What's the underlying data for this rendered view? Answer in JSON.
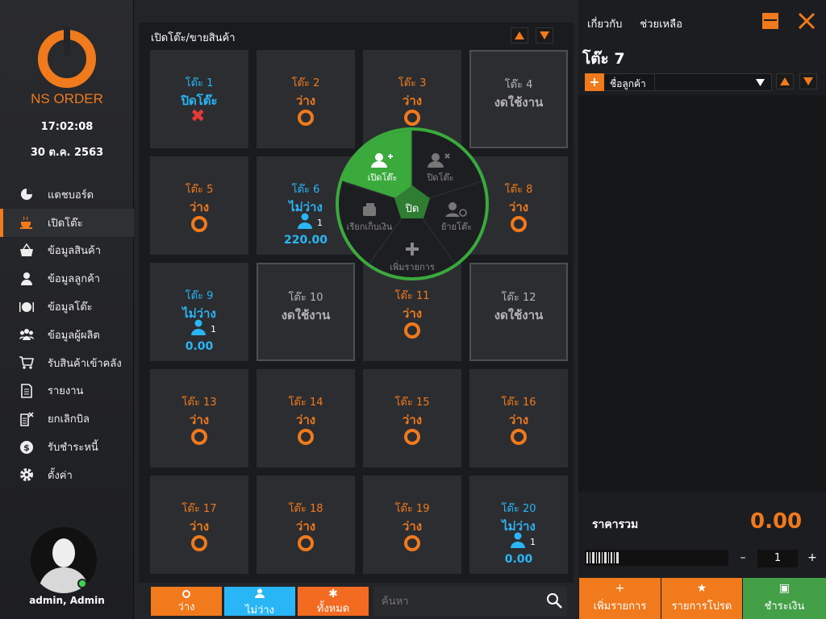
{
  "app": {
    "logo_text": "NS ORDER",
    "time": "17:02:08",
    "date": "30 ต.ค. 2563",
    "user": "admin, Admin"
  },
  "nav": [
    {
      "label": "แดชบอร์ด",
      "icon": "pie-chart-icon"
    },
    {
      "label": "เปิดโต๊ะ",
      "icon": "coffee-icon"
    },
    {
      "label": "ข้อมูลสินค้า",
      "icon": "basket-icon"
    },
    {
      "label": "ข้อมูลลูกค้า",
      "icon": "person-icon"
    },
    {
      "label": "ข้อมูลโต๊ะ",
      "icon": "plate-icon"
    },
    {
      "label": "ข้อมูลผู้ผลิต",
      "icon": "group-icon"
    },
    {
      "label": "รับสินค้าเข้าคลัง",
      "icon": "cart-icon"
    },
    {
      "label": "รายงาน",
      "icon": "document-icon"
    },
    {
      "label": "ยกเลิกบิล",
      "icon": "cancel-bill-icon"
    },
    {
      "label": "รับชำระหนี้",
      "icon": "dollar-icon"
    },
    {
      "label": "ตั้งค่า",
      "icon": "gear-icon"
    }
  ],
  "main": {
    "title": "เปิดโต๊ะ/ขายสินค้า",
    "search_placeholder": "ค้นหา"
  },
  "tables": [
    {
      "name": "โต๊ะ 1",
      "status": "ปิดโต๊ะ",
      "kind": "closed"
    },
    {
      "name": "โต๊ะ 2",
      "status": "ว่าง",
      "kind": "free"
    },
    {
      "name": "โต๊ะ 3",
      "status": "ว่าง",
      "kind": "free"
    },
    {
      "name": "โต๊ะ 4",
      "status": "งดใช้งาน",
      "kind": "disabled"
    },
    {
      "name": "โต๊ะ 5",
      "status": "ว่าง",
      "kind": "free"
    },
    {
      "name": "โต๊ะ 6",
      "status": "ไม่ว่าง",
      "kind": "busy",
      "guests": "1",
      "amount": "220.00"
    },
    {
      "name": "โต๊ะ 7",
      "status": "",
      "kind": "hidden"
    },
    {
      "name": "โต๊ะ 8",
      "status": "ว่าง",
      "kind": "free"
    },
    {
      "name": "โต๊ะ 9",
      "status": "ไม่ว่าง",
      "kind": "busy",
      "guests": "1",
      "amount": "0.00"
    },
    {
      "name": "โต๊ะ 10",
      "status": "งดใช้งาน",
      "kind": "disabled"
    },
    {
      "name": "โต๊ะ 11",
      "status": "ว่าง",
      "kind": "free"
    },
    {
      "name": "โต๊ะ 12",
      "status": "งดใช้งาน",
      "kind": "disabled"
    },
    {
      "name": "โต๊ะ 13",
      "status": "ว่าง",
      "kind": "free"
    },
    {
      "name": "โต๊ะ 14",
      "status": "ว่าง",
      "kind": "free"
    },
    {
      "name": "โต๊ะ 15",
      "status": "ว่าง",
      "kind": "free"
    },
    {
      "name": "โต๊ะ 16",
      "status": "ว่าง",
      "kind": "free"
    },
    {
      "name": "โต๊ะ 17",
      "status": "ว่าง",
      "kind": "free"
    },
    {
      "name": "โต๊ะ 18",
      "status": "ว่าง",
      "kind": "free"
    },
    {
      "name": "โต๊ะ 19",
      "status": "ว่าง",
      "kind": "free"
    },
    {
      "name": "โต๊ะ 20",
      "status": "ไม่ว่าง",
      "kind": "busy",
      "guests": "1",
      "amount": "0.00"
    }
  ],
  "radial": {
    "open": "เปิดโต๊ะ",
    "close_table": "ปิดโต๊ะ",
    "move": "ย้ายโต๊ะ",
    "add": "เพิ่มรายการ",
    "bill": "เรียกเก็บเงิน",
    "center": "ปิด"
  },
  "filters": {
    "free": "ว่าง",
    "busy": "ไม่ว่าง",
    "all": "ทั้งหมด"
  },
  "right": {
    "about": "เกี่ยวกับ",
    "help": "ช่วยเหลือ",
    "table_title": "โต๊ะ 7",
    "customer": "ชื่อลูกค้า",
    "total_label": "ราคารวม",
    "total_value": "0.00",
    "qty": "1",
    "add_item": "เพิ่มรายการ",
    "promo": "รายการโปรด",
    "pay": "ชำระเงิน"
  },
  "colors": {
    "accent": "#f07a1c",
    "busy": "#29b6f6",
    "pay": "#43a047",
    "radial_green": "#3aaa3c"
  }
}
